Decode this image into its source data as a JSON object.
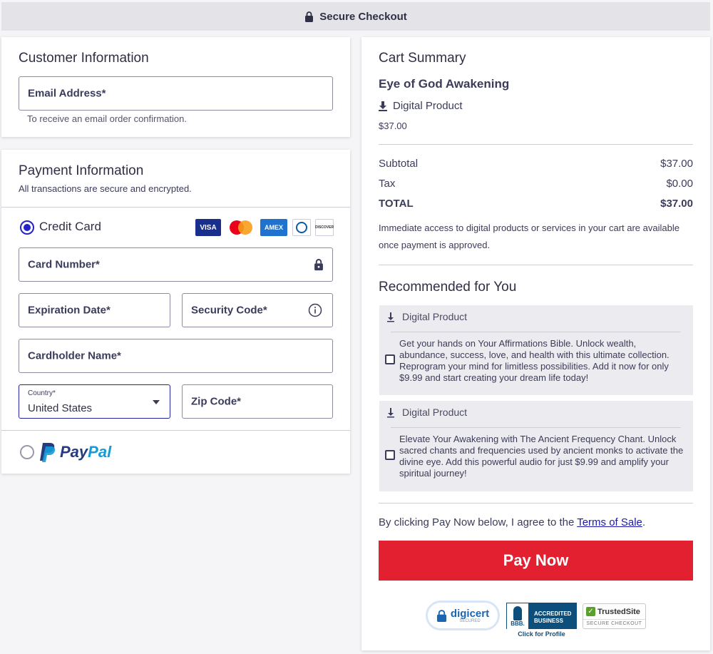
{
  "header": {
    "title": "Secure Checkout",
    "icon": "lock-icon"
  },
  "customer": {
    "title": "Customer Information",
    "email_placeholder": "Email Address*",
    "email_hint": "To receive an email order confirmation."
  },
  "payment": {
    "title": "Payment Information",
    "subtitle": "All transactions are secure and encrypted.",
    "credit_card_label": "Credit Card",
    "card_brands": [
      "VISA",
      "Mastercard",
      "AMEX",
      "Diners",
      "DISCOVER"
    ],
    "card_number_placeholder": "Card Number*",
    "expiration_placeholder": "Expiration Date*",
    "security_code_placeholder": "Security Code*",
    "cardholder_placeholder": "Cardholder Name*",
    "country_label": "Country*",
    "country_value": "United States",
    "zip_placeholder": "Zip Code*",
    "paypal_label_pay": "Pay",
    "paypal_label_pal": "Pal",
    "selected_method": "Credit Card"
  },
  "cart": {
    "title": "Cart Summary",
    "product_name": "Eye of God Awakening",
    "product_type": "Digital Product",
    "product_price": "$37.00",
    "subtotal_label": "Subtotal",
    "subtotal_value": "$37.00",
    "tax_label": "Tax",
    "tax_value": "$0.00",
    "total_label": "TOTAL",
    "total_value": "$37.00",
    "access_note": "Immediate access to digital products or services in your cart are available once payment is approved."
  },
  "recommended": {
    "title": "Recommended for You",
    "items": [
      {
        "type": "Digital Product",
        "text": "Get your hands on Your Affirmations Bible. Unlock wealth, abundance, success, love, and health with this ultimate collection. Reprogram your mind for limitless possibilities. Add it now for only $9.99 and start creating your dream life today!",
        "checked": false
      },
      {
        "type": "Digital Product",
        "text": "Elevate Your Awakening with The Ancient Frequency Chant. Unlock sacred chants and frequencies used by ancient monks to activate the divine eye. Add this powerful audio for just $9.99 and amplify your spiritual journey!",
        "checked": false
      }
    ]
  },
  "terms": {
    "prefix": "By clicking Pay Now below, I agree to the ",
    "link": "Terms of Sale",
    "suffix": "."
  },
  "pay_button": "Pay Now",
  "badges": {
    "digicert_name": "digicert",
    "digicert_sub": "SECURED",
    "bbb_line1": "ACCREDITED",
    "bbb_line2": "BUSINESS",
    "bbb_mark": "BBB.",
    "bbb_caption": "Click for Profile",
    "trusted_name": "TrustedSite",
    "trusted_sub": "SECURE CHECKOUT"
  },
  "colors": {
    "accent": "#2323c8",
    "pay_button": "#e3202f",
    "link": "#1a1aa6"
  }
}
